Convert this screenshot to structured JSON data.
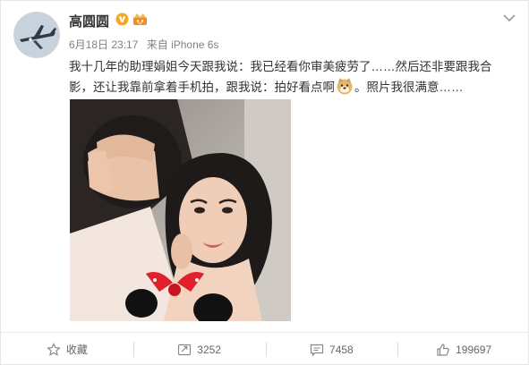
{
  "post": {
    "author": "高圆圆",
    "date": "6月18日 23:17",
    "via": "来自 iPhone 6s",
    "text_line1": "我十几年的助理娟姐今天跟我说：我已经看你审美疲劳了……然后还非要跟我合",
    "text_line2a": "影，还让我靠前拿着手机拍，跟我说：拍好看点啊",
    "text_line2b": "。照片我很满意……"
  },
  "actions": {
    "favorite_label": "收藏",
    "repost_count": "3252",
    "comment_count": "7458",
    "like_count": "199697"
  },
  "colors": {
    "verified_badge": "#f5a623",
    "text": "#333333",
    "meta": "#808080",
    "action_icon": "#888888"
  },
  "icons": {
    "menu": "chevron-down-icon",
    "favorite": "star-icon",
    "repost": "repost-icon",
    "comment": "comment-icon",
    "like": "thumbs-up-icon",
    "verified": "verified-v-icon",
    "vip": "vip-crown-icon",
    "emoji": "doge-emoji-icon"
  }
}
